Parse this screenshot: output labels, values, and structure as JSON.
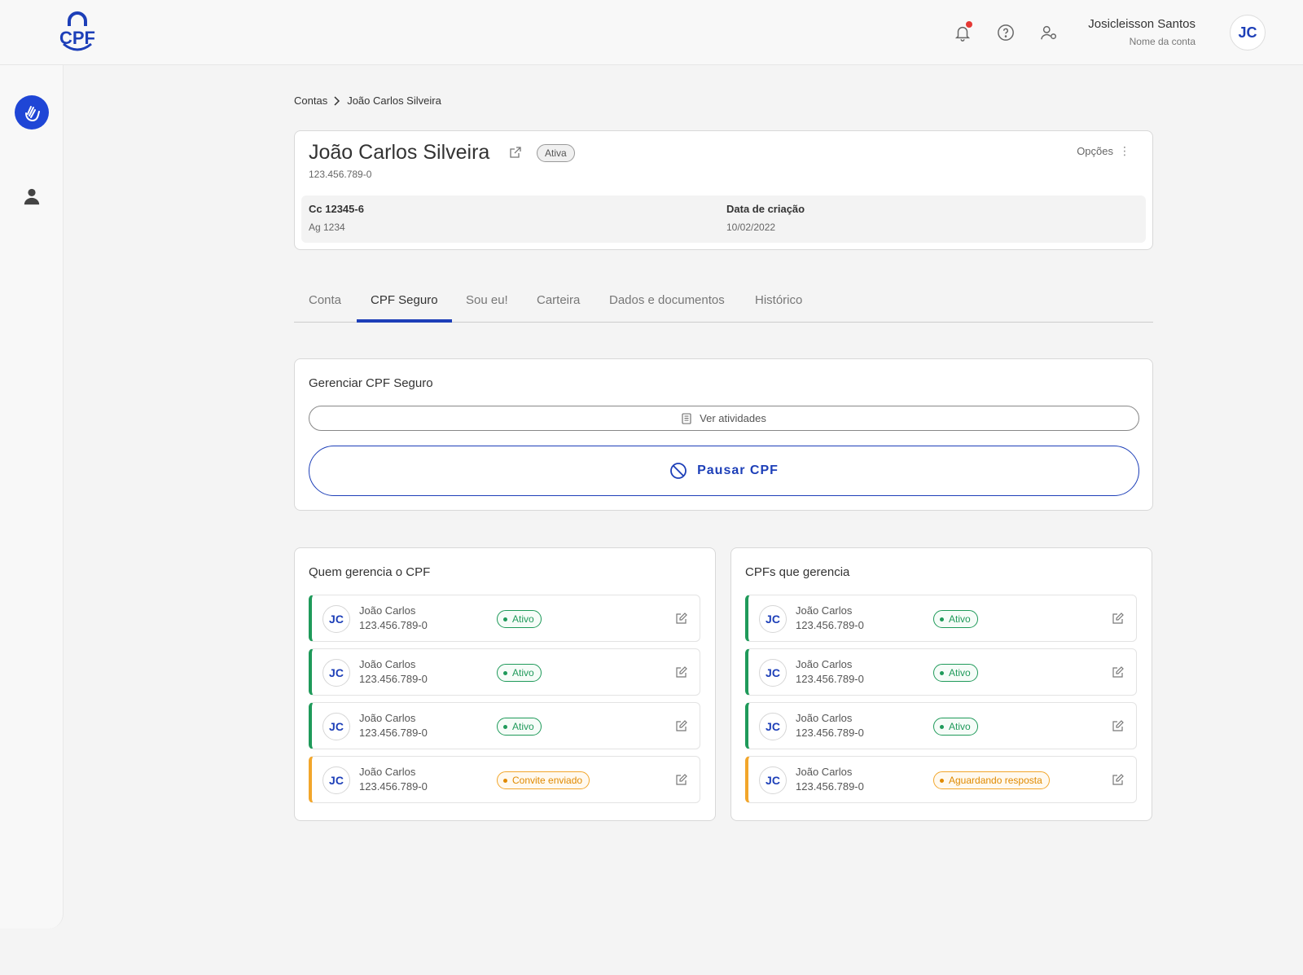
{
  "colors": {
    "primary": "#1d3fb8",
    "success": "#1f9a5a",
    "warning": "#f2a62b"
  },
  "header": {
    "logo_text": "CPF",
    "icons": [
      "bell-icon",
      "help-icon",
      "user-settings-icon"
    ],
    "user_name": "Josicleisson Santos",
    "user_sub": "Nome da conta",
    "user_initials": "JC"
  },
  "breadcrumb": {
    "root": "Contas",
    "current": "João Carlos Silveira"
  },
  "account": {
    "name": "João Carlos Silveira",
    "status": "Ativa",
    "cpf": "123.456.789-0",
    "options_label": "Opções",
    "cc": "Cc 12345-6",
    "ag": "Ag 1234",
    "created_label": "Data de criação",
    "created_value": "10/02/2022"
  },
  "tabs": [
    "Conta",
    "CPF Seguro",
    "Sou eu!",
    "Carteira",
    "Dados e documentos",
    "Histórico"
  ],
  "active_tab": "CPF Seguro",
  "manage": {
    "title": "Gerenciar CPF Seguro",
    "ver_label": "Ver atividades",
    "pausar_label": "Pausar CPF"
  },
  "who_manages": {
    "title": "Quem gerencia o CPF",
    "rows": [
      {
        "initials": "JC",
        "name": "João Carlos",
        "cpf": "123.456.789-0",
        "status": "Ativo",
        "kind": "ok"
      },
      {
        "initials": "JC",
        "name": "João Carlos",
        "cpf": "123.456.789-0",
        "status": "Ativo",
        "kind": "ok"
      },
      {
        "initials": "JC",
        "name": "João Carlos",
        "cpf": "123.456.789-0",
        "status": "Ativo",
        "kind": "ok"
      },
      {
        "initials": "JC",
        "name": "João Carlos",
        "cpf": "123.456.789-0",
        "status": "Convite enviado",
        "kind": "warn"
      }
    ]
  },
  "managed": {
    "title": "CPFs que gerencia",
    "rows": [
      {
        "initials": "JC",
        "name": "João Carlos",
        "cpf": "123.456.789-0",
        "status": "Ativo",
        "kind": "ok"
      },
      {
        "initials": "JC",
        "name": "João Carlos",
        "cpf": "123.456.789-0",
        "status": "Ativo",
        "kind": "ok"
      },
      {
        "initials": "JC",
        "name": "João Carlos",
        "cpf": "123.456.789-0",
        "status": "Ativo",
        "kind": "ok"
      },
      {
        "initials": "JC",
        "name": "João Carlos",
        "cpf": "123.456.789-0",
        "status": "Aguardando resposta",
        "kind": "warn"
      }
    ]
  }
}
